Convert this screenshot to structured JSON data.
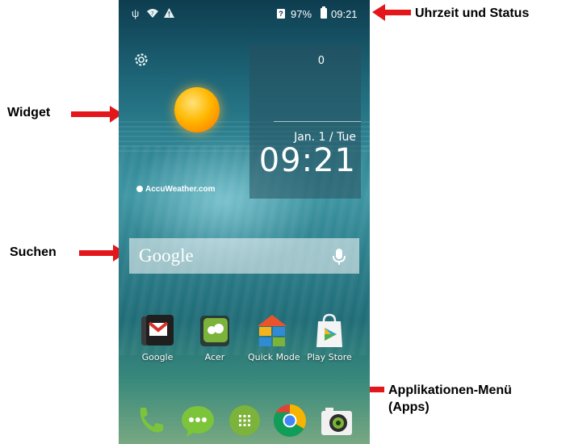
{
  "callouts": {
    "status": "Uhrzeit und Status",
    "widget": "Widget",
    "search": "Suchen",
    "apps_line1": "Applikationen-Menü",
    "apps_line2": "(Apps)"
  },
  "status_bar": {
    "icons": [
      "usb-icon",
      "wifi-unknown-icon",
      "warning-icon"
    ],
    "sim_icon": "?",
    "battery_percent": "97%",
    "time": "09:21"
  },
  "widget": {
    "settings_icon": "gear-icon",
    "weather_icon": "sun-icon",
    "brand": "AccuWeather.com",
    "counter": "0",
    "date": "Jan. 1 / Tue",
    "time": "09:21"
  },
  "search": {
    "logo": "Google",
    "mic_icon": "microphone-icon"
  },
  "apps": [
    {
      "label": "Google",
      "icon": "google-folder-icon"
    },
    {
      "label": "Acer",
      "icon": "acer-folder-icon"
    },
    {
      "label": "Quick Mode",
      "icon": "quick-mode-icon"
    },
    {
      "label": "Play Store",
      "icon": "play-store-icon"
    }
  ],
  "dock": [
    {
      "icon": "phone-icon"
    },
    {
      "icon": "messaging-icon"
    },
    {
      "icon": "app-drawer-icon"
    },
    {
      "icon": "chrome-icon"
    },
    {
      "icon": "camera-icon"
    }
  ],
  "colors": {
    "arrow": "#e3161b",
    "accent_green": "#7cb33a"
  }
}
